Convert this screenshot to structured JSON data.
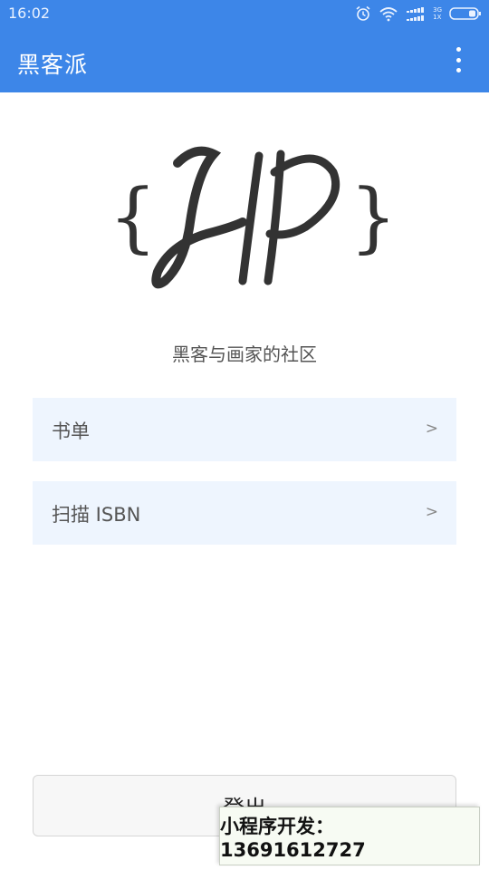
{
  "status_bar": {
    "time": "16:02",
    "network_top": "3G",
    "network_bottom": "1X"
  },
  "app_bar": {
    "title": "黑客派",
    "more_icon": "more-vert-icon"
  },
  "logo": {
    "letters": "HP",
    "open_brace": "{",
    "close_brace": "}"
  },
  "tagline": "黑客与画家的社区",
  "menu": [
    {
      "label": "书单",
      "arrow": ">"
    },
    {
      "label": "扫描 ISBN",
      "arrow": ">"
    }
  ],
  "logout": {
    "label": "登出"
  },
  "watermark": {
    "text": "小程序开发：13691612727"
  },
  "colors": {
    "primary": "#3d86e8",
    "menu_bg": "#eef5fe",
    "logo": "#333333"
  }
}
